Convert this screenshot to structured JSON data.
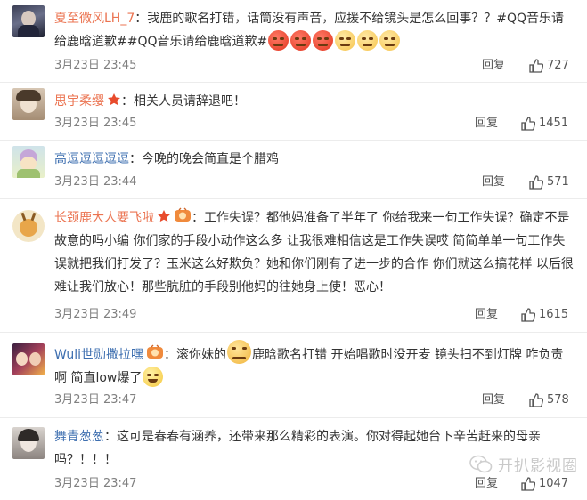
{
  "comments": [
    {
      "user": "夏至微风LH_7",
      "text": "：我鹿的歌名打错，话筒没有声音，应援不给镜头是怎么回事？？#QQ音乐请给鹿晗道歉##QQ音乐请给鹿晗道歉#",
      "emojis": [
        "angry",
        "angry",
        "angry",
        "sad",
        "sad",
        "sad"
      ],
      "time": "3月23日 23:45",
      "reply": "回复",
      "likes": "727"
    },
    {
      "user": "思宇柔缨",
      "text": "：相关人员请辞退吧！",
      "time": "3月23日 23:45",
      "reply": "回复",
      "likes": "1451"
    },
    {
      "user": "高逗逗逗逗逗",
      "text": "：今晚的晚会简直是个腊鸡",
      "time": "3月23日 23:44",
      "reply": "回复",
      "likes": "571"
    },
    {
      "user": "长颈鹿大人要飞啦",
      "text": "：工作失误？都他妈准备了半年了 你给我来一句工作失误？确定不是故意的吗小编 你们家的手段小动作这么多 让我很难相信这是工作失误哎 简简单单一句工作失误就把我们打发了？玉米这么好欺负？她和你们刚有了进一步的合作 你们就这么搞花样 以后很难让我们放心！那些肮脏的手段别他妈的往她身上使！恶心！",
      "time": "3月23日 23:49",
      "reply": "回复",
      "likes": "1615"
    },
    {
      "user": "Wuli世勋撒拉嘿",
      "text_a": "：滚你妹的",
      "text_b": "鹿晗歌名打错 开始唱歌时没开麦 镜头扫不到灯牌 咋负责啊 简直low爆了",
      "time": "3月23日 23:47",
      "reply": "回复",
      "likes": "578"
    },
    {
      "user": "舞青葱葱",
      "text": "：这可是春春有涵养，还带来那么精彩的表演。你对得起她台下辛苦赶来的母亲吗？！！！",
      "time": "3月23日 23:47",
      "reply": "回复",
      "likes": "1047"
    }
  ],
  "watermark": "开扒影视圈",
  "colors": {
    "username": "#eb7350",
    "username_blue": "#3e6fb0",
    "meta": "#808080",
    "divider": "#ececec"
  }
}
